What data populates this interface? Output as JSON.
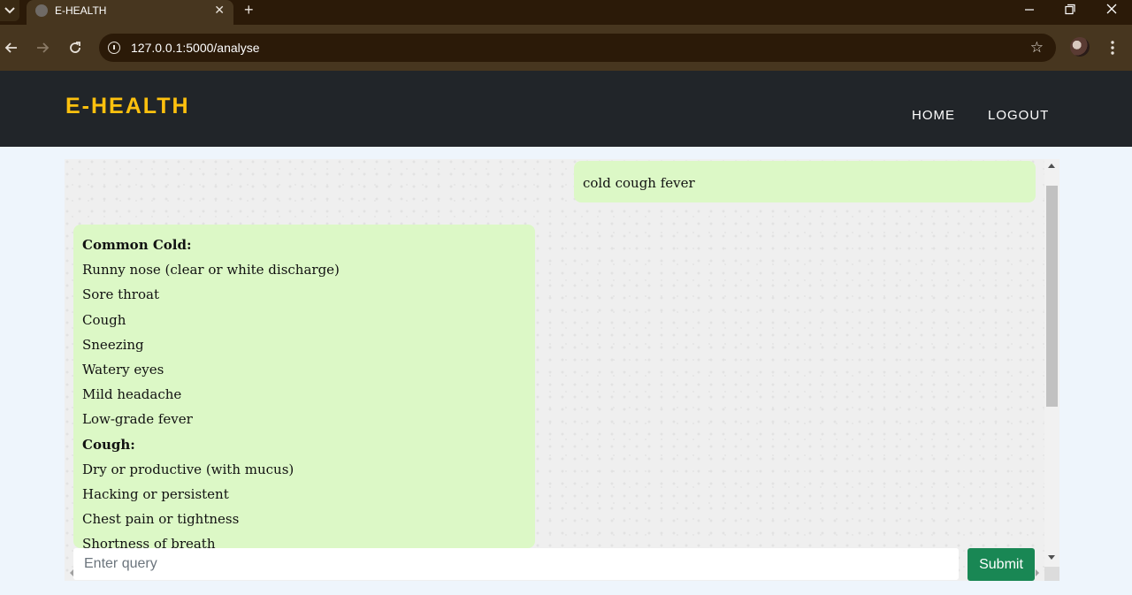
{
  "browser": {
    "tab_title": "E-HEALTH",
    "url": "127.0.0.1:5000/analyse"
  },
  "navbar": {
    "brand": "E-HEALTH",
    "links": [
      "HOME",
      "LOGOUT"
    ]
  },
  "chat": {
    "user_message": "cold cough fever",
    "response_lines": [
      {
        "text": "Common Cold:",
        "bold": true
      },
      {
        "text": "Runny nose (clear or white discharge)",
        "bold": false
      },
      {
        "text": "Sore throat",
        "bold": false
      },
      {
        "text": "Cough",
        "bold": false
      },
      {
        "text": "Sneezing",
        "bold": false
      },
      {
        "text": "Watery eyes",
        "bold": false
      },
      {
        "text": "Mild headache",
        "bold": false
      },
      {
        "text": "Low-grade fever",
        "bold": false
      },
      {
        "text": "Cough:",
        "bold": true
      },
      {
        "text": "Dry or productive (with mucus)",
        "bold": false
      },
      {
        "text": "Hacking or persistent",
        "bold": false
      },
      {
        "text": "Chest pain or tightness",
        "bold": false
      },
      {
        "text": "Shortness of breath",
        "bold": false
      }
    ],
    "input_placeholder": "Enter query",
    "input_value": "",
    "submit_label": "Submit"
  },
  "colors": {
    "brand": "#fec10e",
    "navbar_bg": "#212529",
    "bubble_bg": "#dcf8c6",
    "submit_bg": "#198754"
  }
}
